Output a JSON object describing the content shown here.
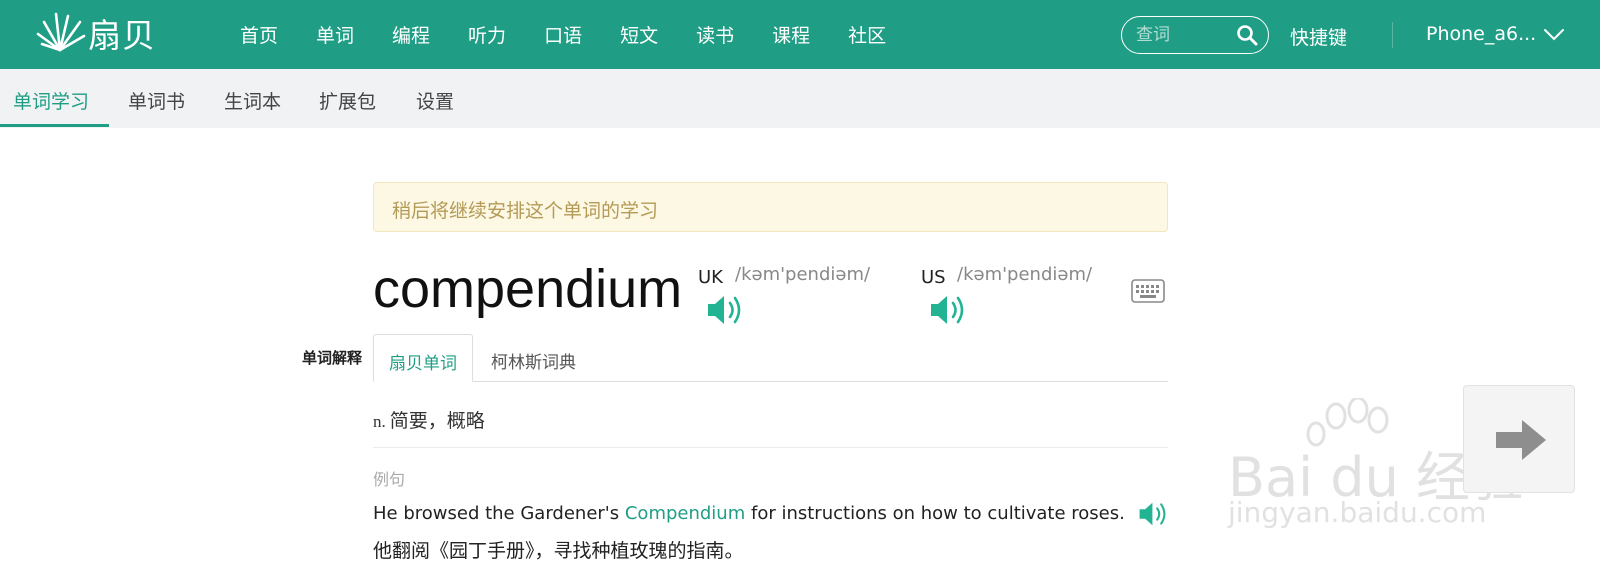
{
  "brand": {
    "name": "扇贝",
    "color": "#209e85"
  },
  "nav": {
    "items": [
      "首页",
      "单词",
      "编程",
      "听力",
      "口语",
      "短文",
      "读书",
      "课程",
      "社区"
    ]
  },
  "search": {
    "placeholder": "查词",
    "icon": "search-icon"
  },
  "shortcut_label": "快捷键",
  "user": {
    "name": "Phone_a6...",
    "icon": "chevron-down-icon"
  },
  "subnav": {
    "items": [
      "单词学习",
      "单词书",
      "生词本",
      "扩展包",
      "设置"
    ],
    "active_index": 0
  },
  "notice": "稍后将继续安排这个单词的学习",
  "word": {
    "text": "compendium",
    "uk": {
      "label": "UK",
      "phonetic": "/kəm'pendiəm/"
    },
    "us": {
      "label": "US",
      "phonetic": "/kəm'pendiəm/"
    }
  },
  "definitions": {
    "label": "单词解释",
    "tabs": [
      "扇贝单词",
      "柯林斯词典"
    ],
    "active_tab": 0,
    "pos": "n.",
    "meaning": "简要，概略"
  },
  "example": {
    "label": "例句",
    "en_before": "He browsed the Gardener's ",
    "en_highlight": "Compendium",
    "en_after": " for instructions on how to cultivate roses.",
    "cn": "他翻阅《园丁手册》，寻找种植玫瑰的指南。"
  },
  "watermark": {
    "brand": "Bai du 经验",
    "url": "jingyan.baidu.com"
  }
}
